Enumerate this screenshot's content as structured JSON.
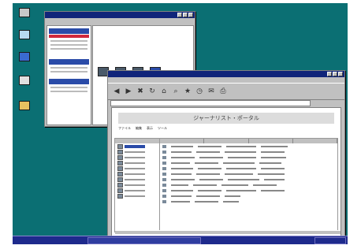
{
  "desktop": {
    "icons": [
      {
        "name": "desktop-icon-1",
        "color": "#c8c8c8"
      },
      {
        "name": "desktop-icon-2",
        "color": "#b8d8f0"
      },
      {
        "name": "desktop-icon-3",
        "color": "#3a6ad0"
      },
      {
        "name": "desktop-icon-4",
        "color": "#e0e0e0"
      },
      {
        "name": "desktop-icon-5",
        "color": "#e8c060"
      }
    ]
  },
  "back_window": {
    "accent": "#2a4ba8"
  },
  "front_window": {
    "banner_title": "ジャーナリスト・ポータル",
    "content_menu": [
      "ファイル",
      "編集",
      "表示",
      "ツール"
    ]
  },
  "colors": {
    "desktop": "#0b6f73",
    "title_active": "#10247a",
    "taskbar": "#1e2a8c"
  }
}
